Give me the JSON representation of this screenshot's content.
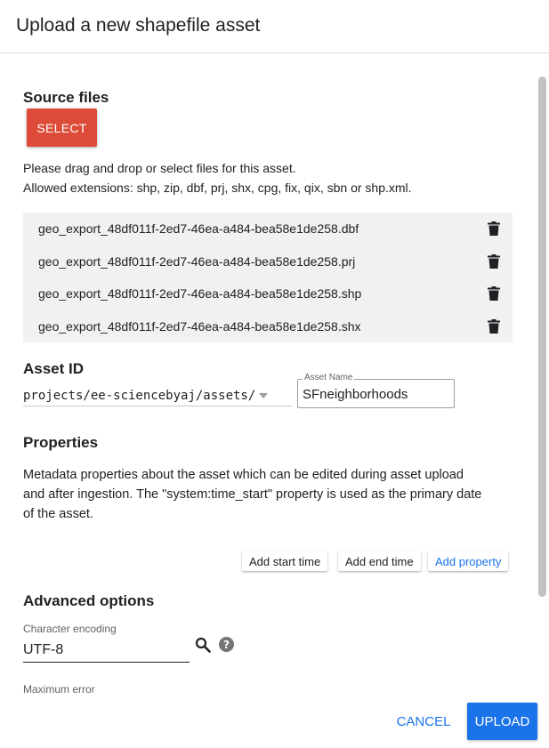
{
  "dialog": {
    "title": "Upload a new shapefile asset"
  },
  "source_files": {
    "heading": "Source files",
    "select_label": "SELECT",
    "help_line1": "Please drag and drop or select files for this asset.",
    "help_line2": "Allowed extensions: shp, zip, dbf, prj, shx, cpg, fix, qix, sbn or shp.xml.",
    "files": [
      "geo_export_48df011f-2ed7-46ea-a484-bea58e1de258.dbf",
      "geo_export_48df011f-2ed7-46ea-a484-bea58e1de258.prj",
      "geo_export_48df011f-2ed7-46ea-a484-bea58e1de258.shp",
      "geo_export_48df011f-2ed7-46ea-a484-bea58e1de258.shx"
    ],
    "delete_icon": "trash-icon"
  },
  "asset_id": {
    "heading": "Asset ID",
    "prefix": "projects/ee-sciencebyaj/assets/",
    "name_label": "Asset Name",
    "name_value": "SFneighborhoods"
  },
  "properties": {
    "heading": "Properties",
    "line1": "Metadata properties about the asset which can be edited during asset upload",
    "line2": "and after ingestion. The \"system:time_start\" property is used as the primary date",
    "line3": "of the asset.",
    "add_start_time": "Add start time",
    "add_end_time": "Add end time",
    "add_property": "Add property"
  },
  "advanced": {
    "heading": "Advanced options",
    "encoding_label": "Character encoding",
    "encoding_value": "UTF-8",
    "max_error_label": "Maximum error"
  },
  "footer": {
    "cancel_label": "CANCEL",
    "upload_label": "UPLOAD"
  },
  "colors": {
    "select_button": "#dd4b39",
    "primary_blue": "#1a73e8",
    "file_list_bg": "#f1f1f1"
  }
}
